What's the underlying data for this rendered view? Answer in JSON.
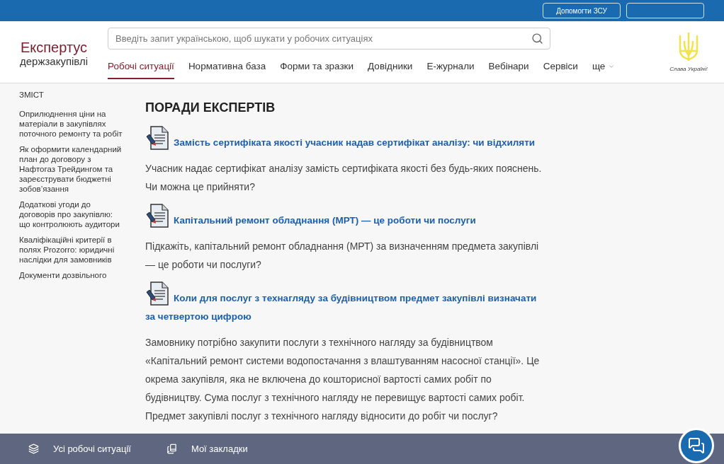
{
  "top_bar": {
    "buttons": [
      {
        "kind": "text",
        "label": "Допомогти ЗСУ"
      },
      {
        "kind": "blank"
      }
    ]
  },
  "logo": {
    "title": "Експертус",
    "subtitle": "держзакупівлі"
  },
  "search": {
    "placeholder": "Введіть запит українською, щоб шукати у робочих ситуаціях"
  },
  "nav": [
    {
      "label": "Робочі ситуації",
      "selected": true
    },
    {
      "label": "Нормативна база",
      "selected": false
    },
    {
      "label": "Форми та зразки",
      "selected": false
    },
    {
      "label": "Довідники",
      "selected": false
    },
    {
      "label": "Е-журнали",
      "selected": false
    },
    {
      "label": "Вебінари",
      "selected": false
    },
    {
      "label": "Сервіси",
      "selected": false
    },
    {
      "label": "ще",
      "selected": false,
      "kind": "dropdown"
    }
  ],
  "emblem": {
    "caption": "Слава Україні!"
  },
  "sidebar": {
    "title": "ЗМІСТ",
    "items": [
      "Оприлюднення ціни на матеріали в закупівлях поточного ремонту та робіт",
      "Як оформити календарний план до договору з Нафтогаз Трейдингом та зареєструвати бюджетні зобов’язання",
      "Додаткові угоди до договорів про закупівлю: що контролюють аудитори",
      "Кваліфікаційні критерії в полях Prozorro: юридичні наслідки для замовників",
      "Документи дозвільного"
    ]
  },
  "content": {
    "heading": "ПОРАДИ ЕКСПЕРТІВ",
    "articles": [
      {
        "title": "Замість сертифіката якості учасник надав сертифікат аналізу: чи відхиляти",
        "text": "Учасник надає сертифікат аналізу замість сертифіката якості без будь-яких пояснень. Чи можна це прийняти?"
      },
      {
        "title": "Капітальний ремонт обладнання (МРТ) — це роботи чи послуги",
        "text": "Підкажіть, капітальний ремонт обладнання (МРТ) за визначенням предмета закупівлі — це роботи чи послуги?"
      },
      {
        "title": "Коли для послуг з технагляду за будівництвом предмет закупівлі визначати за четвертою цифрою",
        "text": "Замовнику потрібно закупити послуги з технічного нагляду за будівництвом «Капітальний ремонт системи водопостачання з влаштуванням насосної станції». Це окрема закупівля, яка не включена до кошторисної вартості самих робіт по будівництву. Сума послуг з технічного нагляду не перевищує вартості самих робіт. Предмет закупівлі послуг з технічного нагляду відносити до робіт чи послуг?"
      }
    ]
  },
  "bottom_bar": {
    "items": [
      {
        "label": "Усі робочі ситуації",
        "kind": "layers"
      },
      {
        "label": "Мої закладки",
        "kind": "bookmark"
      }
    ]
  }
}
